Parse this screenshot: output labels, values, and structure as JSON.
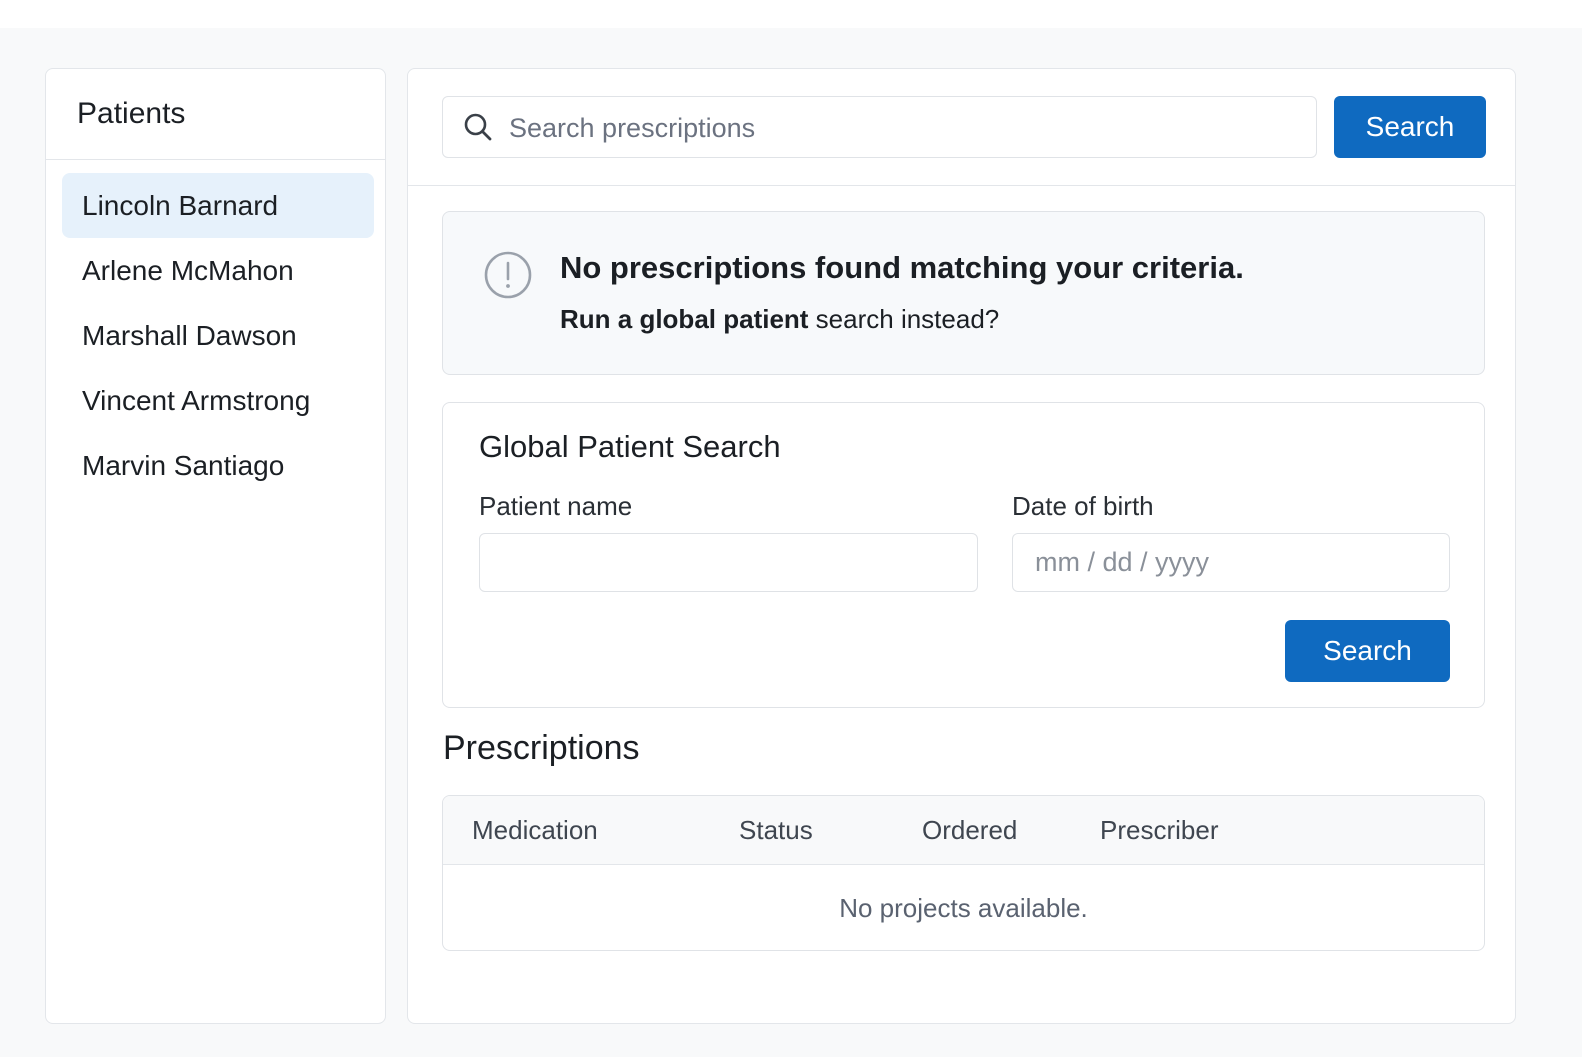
{
  "sidebar": {
    "title": "Patients",
    "patients": [
      {
        "name": "Lincoln Barnard",
        "active": true
      },
      {
        "name": "Arlene McMahon",
        "active": false
      },
      {
        "name": "Marshall Dawson",
        "active": false
      },
      {
        "name": "Vincent Armstrong",
        "active": false
      },
      {
        "name": "Marvin Santiago",
        "active": false
      }
    ]
  },
  "search": {
    "icon": "search-icon",
    "placeholder": "Search prescriptions",
    "value": "",
    "button_label": "Search"
  },
  "alert": {
    "icon": "exclamation-circle-icon",
    "title": "No prescriptions found matching your criteria.",
    "link_text": "Run a global patient",
    "rest_text": " search instead?"
  },
  "global_search": {
    "title": "Global Patient Search",
    "name_label": "Patient name",
    "name_value": "",
    "dob_label": "Date of birth",
    "dob_placeholder": "mm / dd / yyyy",
    "button_label": "Search"
  },
  "prescriptions": {
    "title": "Prescriptions",
    "columns": [
      "Medication",
      "Status",
      "Ordered",
      "Prescriber"
    ],
    "empty_message": "No projects available."
  },
  "colors": {
    "primary": "#0f6ac0",
    "active_item": "#e6f1fb",
    "page_background": "#f8f9fa",
    "border": "#e0e3e7"
  }
}
